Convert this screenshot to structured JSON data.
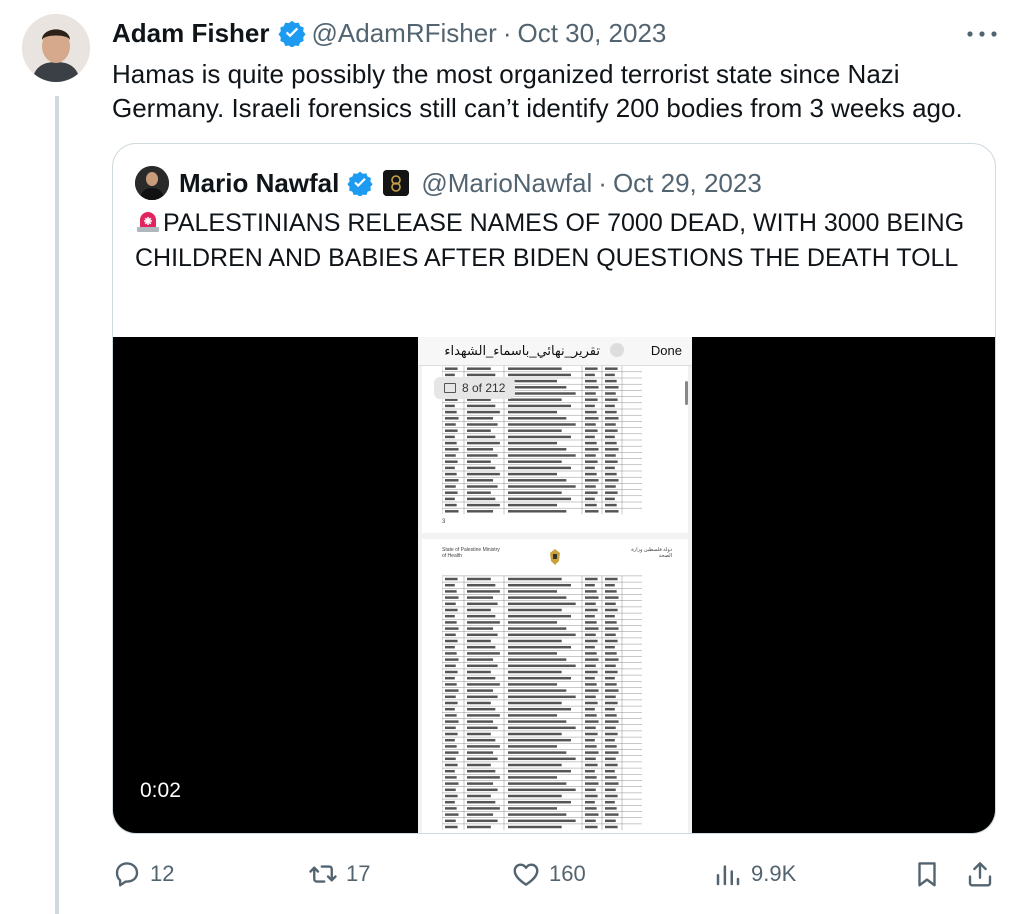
{
  "tweet": {
    "author_name": "Adam Fisher",
    "handle": "@AdamRFisher",
    "separator": "·",
    "date": "Oct 30, 2023",
    "text": "Hamas is quite possibly the most organized terrorist state since Nazi Germany. Israeli forensics still can’t identify 200 bodies from 3 weeks ago."
  },
  "quote": {
    "author_name": "Mario Nawfal",
    "handle": "@MarioNawfal",
    "separator": "·",
    "date": "Oct 29, 2023",
    "text": "PALESTINIANS RELEASE NAMES OF 7000 DEAD, WITH 3000 BEING CHILDREN AND BABIES AFTER BIDEN QUESTIONS THE DEATH TOLL",
    "video": {
      "doc_title": "تقرير_نهائي_باسماء_الشهداء",
      "done_label": "Done",
      "page_indicator": "8 of 212",
      "page_number": "3",
      "header_left": "State of Palestine Ministry of Health",
      "header_right": "دولة فلسطين وزارة الصحة",
      "timestamp": "0:02"
    }
  },
  "actions": {
    "replies": "12",
    "reposts": "17",
    "likes": "160",
    "views": "9.9K"
  },
  "colors": {
    "verified": "#1d9bf0",
    "muted_text": "#536471",
    "border": "#cfd9de"
  }
}
